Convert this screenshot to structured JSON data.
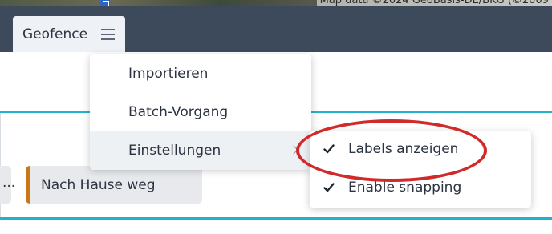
{
  "map": {
    "attribution": "Map data ©2024 GeoBasis-DE/BKG (©2009",
    "marker_icon": "map-marker-icon"
  },
  "toolbar": {
    "tab_label": "Geofence",
    "menu_icon": "hamburger-menu-icon"
  },
  "background": {
    "left_pill_text": "...",
    "home_pill_text": "Nach Hause weg",
    "home_pill_accent": "#c87819",
    "line_color": "#24b1cf"
  },
  "menu": {
    "items": [
      {
        "label": "Importieren"
      },
      {
        "label": "Batch-Vorgang"
      },
      {
        "label": "Einstellungen",
        "has_submenu": true,
        "selected": true
      }
    ],
    "chevron_icon": "chevron-right-icon"
  },
  "submenu": {
    "items": [
      {
        "label": "Labels anzeigen",
        "checked": true
      },
      {
        "label": "Enable snapping",
        "checked": true
      }
    ],
    "check_icon": "checkmark-icon"
  },
  "annotation": {
    "highlight_color": "#d12a2a"
  }
}
